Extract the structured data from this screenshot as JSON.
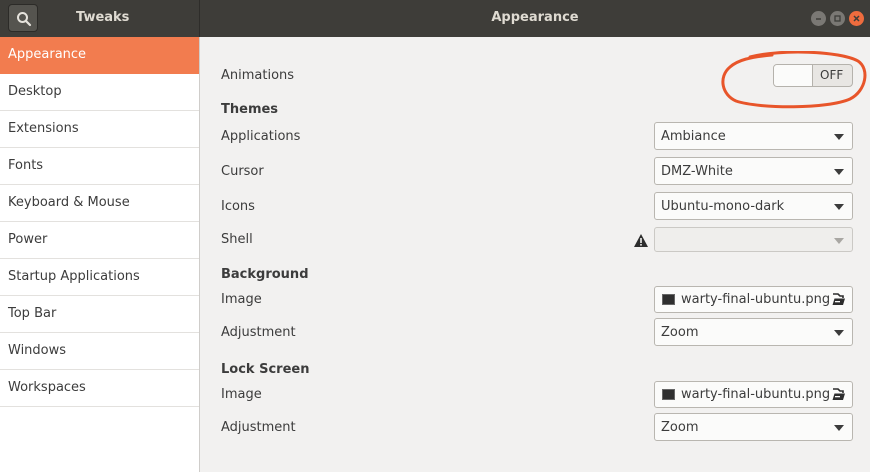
{
  "titlebar": {
    "app_title": "Tweaks",
    "page_title": "Appearance"
  },
  "sidebar": {
    "items": [
      {
        "label": "Appearance",
        "selected": true
      },
      {
        "label": "Desktop"
      },
      {
        "label": "Extensions"
      },
      {
        "label": "Fonts"
      },
      {
        "label": "Keyboard & Mouse"
      },
      {
        "label": "Power"
      },
      {
        "label": "Startup Applications"
      },
      {
        "label": "Top Bar"
      },
      {
        "label": "Windows"
      },
      {
        "label": "Workspaces"
      }
    ]
  },
  "appearance": {
    "animations": {
      "label": "Animations",
      "state": "OFF"
    },
    "themes": {
      "heading": "Themes",
      "applications": {
        "label": "Applications",
        "value": "Ambiance"
      },
      "cursor": {
        "label": "Cursor",
        "value": "DMZ-White"
      },
      "icons": {
        "label": "Icons",
        "value": "Ubuntu-mono-dark"
      },
      "shell": {
        "label": "Shell",
        "value": ""
      }
    },
    "background": {
      "heading": "Background",
      "image": {
        "label": "Image",
        "value": "warty-final-ubuntu.png"
      },
      "adjustment": {
        "label": "Adjustment",
        "value": "Zoom"
      }
    },
    "lock_screen": {
      "heading": "Lock Screen",
      "image": {
        "label": "Image",
        "value": "warty-final-ubuntu.png"
      },
      "adjustment": {
        "label": "Adjustment",
        "value": "Zoom"
      }
    }
  },
  "colors": {
    "accent": "#f27c4f",
    "titlebar": "#3e3d39",
    "annotation": "#e8552a"
  }
}
